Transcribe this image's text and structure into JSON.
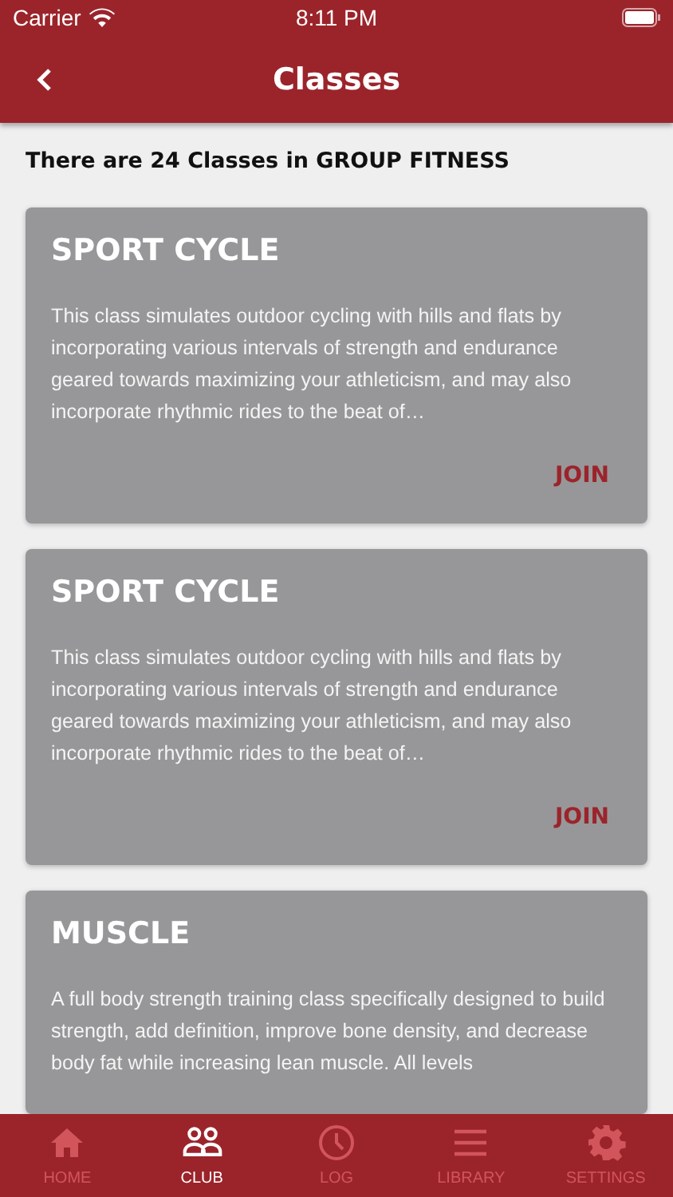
{
  "status_bar": {
    "carrier": "Carrier",
    "time": "8:11 PM"
  },
  "nav_bar": {
    "title": "Classes"
  },
  "summary": "There are 24 Classes in GROUP FITNESS",
  "classes": [
    {
      "name": "SPORT CYCLE",
      "description": "This class simulates outdoor cycling with hills and flats by incorporating various intervals of strength and endurance geared towards maximizing your athleticism, and may also incorporate rhythmic rides to the beat of…",
      "action": "JOIN"
    },
    {
      "name": "SPORT CYCLE",
      "description": "This class simulates outdoor cycling with hills and flats by incorporating various intervals of strength and endurance geared towards maximizing your athleticism, and may also incorporate rhythmic rides to the beat of…",
      "action": "JOIN"
    },
    {
      "name": "MUSCLE",
      "description": "A full body strength training class specifically designed to build strength, add definition, improve bone density, and decrease body fat while increasing lean muscle. All levels"
    }
  ],
  "tab_bar": [
    {
      "kind": "home",
      "label": "HOME",
      "selected": false
    },
    {
      "kind": "club",
      "label": "CLUB",
      "selected": true
    },
    {
      "kind": "log",
      "label": "LOG",
      "selected": false
    },
    {
      "kind": "library",
      "label": "LIBRARY",
      "selected": false
    },
    {
      "kind": "settings",
      "label": "SETTINGS",
      "selected": false
    }
  ]
}
